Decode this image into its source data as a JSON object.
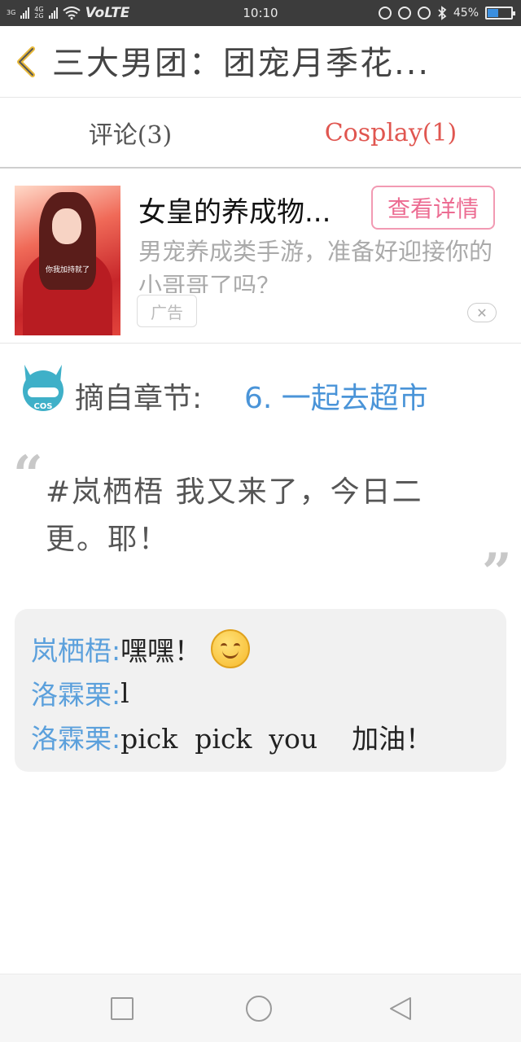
{
  "status_bar": {
    "network_1": "3G",
    "network_2": "4G",
    "network_3": "2G",
    "volte": "VoLTE",
    "time": "10:10",
    "battery": "45%",
    "battery_level": 0.45
  },
  "header": {
    "title": "三大男团：团宠月季花..."
  },
  "tabs": [
    {
      "label": "评论(3)",
      "active": false
    },
    {
      "label": "Cosplay(1)",
      "active": true
    }
  ],
  "ad": {
    "image_caption": "你我加持就了",
    "title": "女皇的养成物...",
    "button": "查看详情",
    "description": "男宠养成类手游，准备好迎接你的小哥哥了吗？",
    "tag": "广告",
    "close": "✕"
  },
  "chapter": {
    "mascot_label": "COS",
    "label": "摘自章节:",
    "link": "6. 一起去超市"
  },
  "quote": {
    "open": "“",
    "close": "”",
    "text": "#岚栖梧 我又来了，今日二更。耶！"
  },
  "replies": [
    {
      "name": "岚栖梧:",
      "text": "嘿嘿！",
      "emoji": "smile-emoji"
    },
    {
      "name": "洛霖栗:",
      "text": "l"
    },
    {
      "name": "洛霖栗:",
      "text": "pick  pick  you    加油！"
    }
  ],
  "colors": {
    "accent_tab": "#e05650",
    "link": "#4a94d8",
    "reply_name": "#5ba0dc",
    "ad_button": "#ec6c92"
  }
}
